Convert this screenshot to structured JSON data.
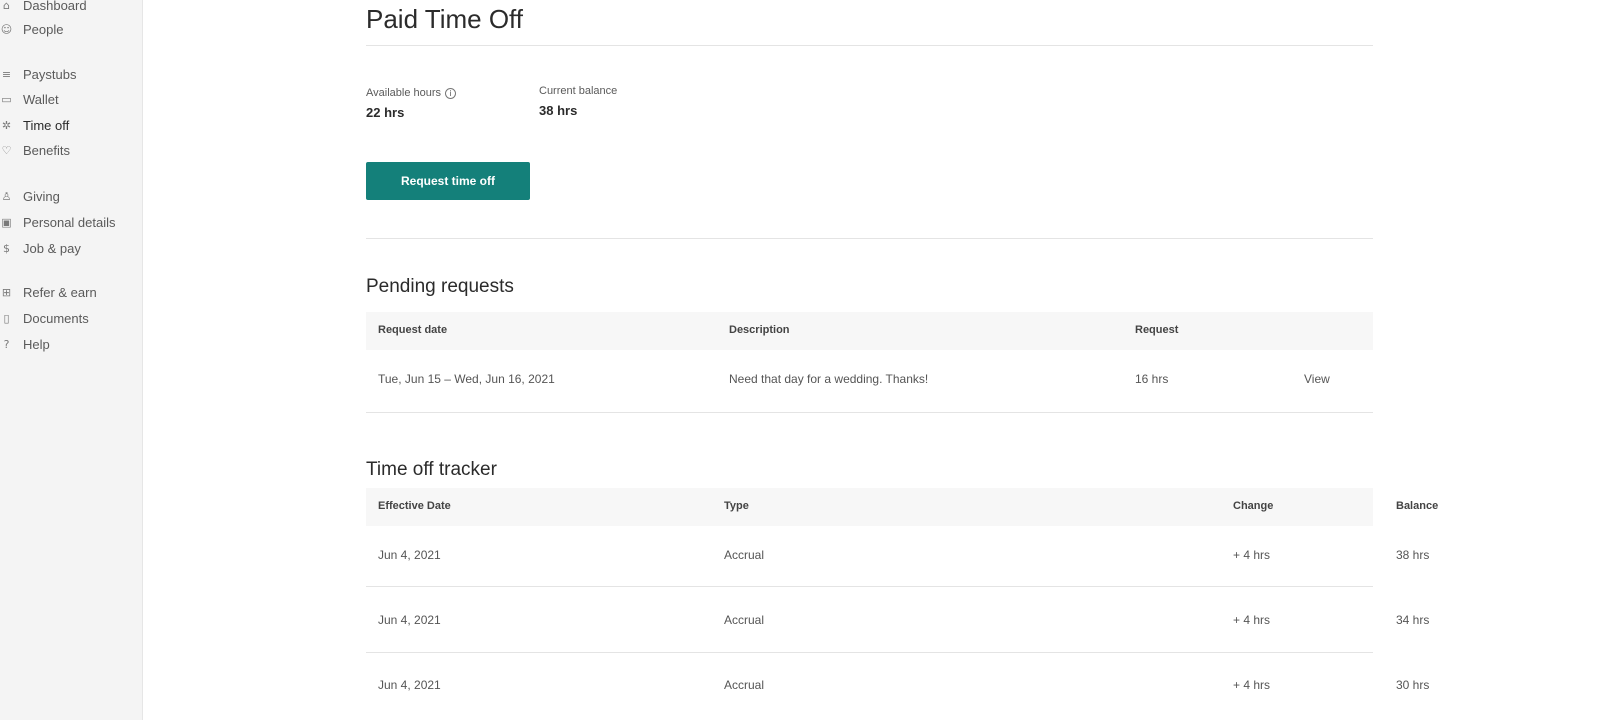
{
  "sidebar": {
    "items": [
      {
        "icon": "⌂",
        "icon_name": "dashboard-icon",
        "label": "Dashboard"
      },
      {
        "icon": "☺",
        "icon_name": "people-icon",
        "label": "People"
      },
      {
        "icon": "≡",
        "icon_name": "paystubs-icon",
        "label": "Paystubs"
      },
      {
        "icon": "▭",
        "icon_name": "wallet-icon",
        "label": "Wallet"
      },
      {
        "icon": "✲",
        "icon_name": "time-off-icon",
        "label": "Time off"
      },
      {
        "icon": "♡",
        "icon_name": "benefits-icon",
        "label": "Benefits"
      },
      {
        "icon": "♙",
        "icon_name": "giving-icon",
        "label": "Giving"
      },
      {
        "icon": "▣",
        "icon_name": "personal-details-icon",
        "label": "Personal details"
      },
      {
        "icon": "$",
        "icon_name": "job-pay-icon",
        "label": "Job & pay"
      },
      {
        "icon": "⊞",
        "icon_name": "refer-earn-icon",
        "label": "Refer & earn"
      },
      {
        "icon": "▯",
        "icon_name": "documents-icon",
        "label": "Documents"
      },
      {
        "icon": "?",
        "icon_name": "help-icon",
        "label": "Help"
      }
    ]
  },
  "page": {
    "title": "Paid Time Off",
    "available_hours_label": "Available hours",
    "available_hours_value": "22 hrs",
    "current_balance_label": "Current balance",
    "current_balance_value": "38 hrs",
    "request_button": "Request time off"
  },
  "pending": {
    "title": "Pending requests",
    "headers": [
      "Request date",
      "Description",
      "Request"
    ],
    "rows": [
      {
        "date": "Tue, Jun 15 – Wed, Jun 16, 2021",
        "description": "Need that day for a wedding. Thanks!",
        "request": "16 hrs",
        "action": "View"
      }
    ]
  },
  "tracker": {
    "title": "Time off tracker",
    "headers": [
      "Effective Date",
      "Type",
      "Change",
      "Balance"
    ],
    "rows": [
      {
        "date": "Jun 4, 2021",
        "type": "Accrual",
        "change": "+ 4 hrs",
        "balance": "38 hrs"
      },
      {
        "date": "Jun 4, 2021",
        "type": "Accrual",
        "change": "+ 4 hrs",
        "balance": "34 hrs"
      },
      {
        "date": "Jun 4, 2021",
        "type": "Accrual",
        "change": "+ 4 hrs",
        "balance": "30 hrs"
      }
    ]
  },
  "colors": {
    "accent": "#14807a"
  }
}
